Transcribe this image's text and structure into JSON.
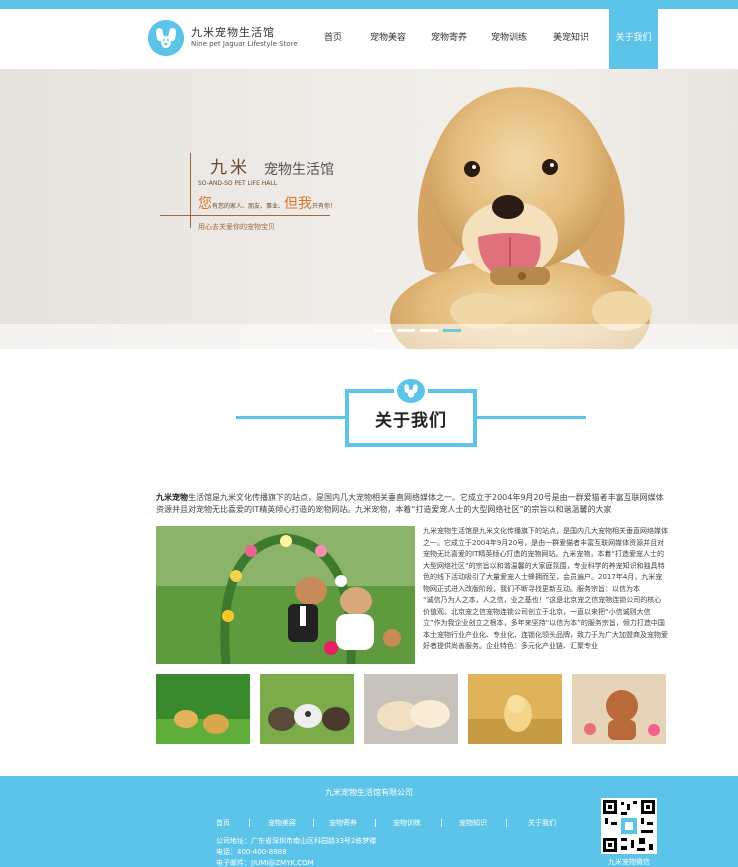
{
  "header": {
    "logo_cn": "九米宠物生活馆",
    "logo_en": "Nine pet Jaguar Lifestyle Store",
    "nav": [
      {
        "label": "首页"
      },
      {
        "label": "宠物美容"
      },
      {
        "label": "宠物寄养"
      },
      {
        "label": "宠物训练"
      },
      {
        "label": "美宠知识"
      },
      {
        "label": "关于我们"
      }
    ],
    "active_index": 5
  },
  "banner": {
    "jiumi": "九米",
    "title": "宠物生活馆",
    "sub": "SO-AND-SO PET LIFE HALL",
    "line_a": "您",
    "line_b": "有您的家人、朋友、事业、",
    "line_c": "但我",
    "line_d": "只有你！",
    "love": "用心去关爱你的宠物宝贝",
    "slides": 4,
    "active_slide": 4
  },
  "section": {
    "title": "关于我们"
  },
  "intro": {
    "brand": "九米宠物",
    "text": "生活馆是九米文化传播旗下的站点，是国内几大宠物相关垂直网络媒体之一。它成立于2004年9月20号是由一群爱猫者丰富互联网媒体资源并且对宠物无比喜爱的IT精英倾心打造的宠物网站。九米宠物，本着“打造爱宠人士的大型网络社区”的宗旨以和谐温馨的大家"
  },
  "side_text": [
    "九米宠物生活馆是九米文化传播旗下的站点，是国内几大宠物相关垂直网络媒体之一。它成立于2004年9月20号，是由一群爱猫者丰富互联网媒体资源并且对宠物无比喜爱的IT精英倾心打造的宠物网站。九米宠物，本着“打造爱宠人士的大型网络社区”的宗旨以和谐温馨的大家庭氛围，专业科学的养宠知识和独具特色的线下活动吸引了大量爱宠人士蜂拥而至，会员遍户。2017年4月，九米宠物网正式进入改版阶段，我们不断寻找更新互动。服务宗旨：以信为本",
    "“诚信乃为人之本，人之信，业之基也！”这是北京宠之信宠物连锁公司的核心价值观。北京宠之信宠物连锁公司创立于北京，一直以来把“小信诚则大信立”作为我企业创立之根本，多年来坚持“以信为本”的服务宗旨，倾力打造中国本土宠物行业产业化、专业化、连锁化领头品牌，致力于为广大加盟商及宠物爱好者提供尚善服务。企业特色：多元化产业链、汇聚专业"
  ],
  "footer": {
    "company": "九米宠物生活馆有限公司",
    "nav": [
      {
        "label": "首页"
      },
      {
        "label": "宠物美容"
      },
      {
        "label": "宠物寄养"
      },
      {
        "label": "宠物训练"
      },
      {
        "label": "宠物知识"
      },
      {
        "label": "关于我们"
      }
    ],
    "address": "公司地址：广东省深圳市南山区科园路33号2栋梦楼",
    "phone": "电话：400-400-8888",
    "email": "电子邮件：JIUMI@ZMYK.COM",
    "qr_label": "九米宠物微信"
  },
  "colors": {
    "accent": "#5bc4e8",
    "brown": "#6b4a2a",
    "orange": "#d9732a"
  }
}
